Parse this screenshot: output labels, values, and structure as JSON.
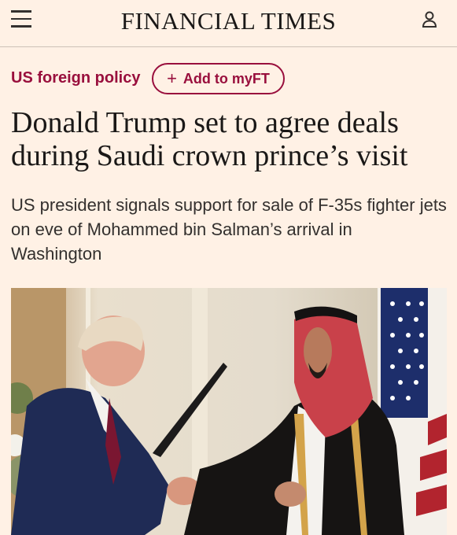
{
  "header": {
    "brand": "FINANCIAL TIMES",
    "menu_icon": "hamburger-menu-icon",
    "account_icon": "user-account-icon"
  },
  "topic": {
    "label": "US foreign policy",
    "follow_label": "Add to myFT",
    "follow_icon": "plus-icon"
  },
  "article": {
    "headline": "Donald Trump set to agree deals during Saudi crown prince’s visit",
    "standfirst": "US president signals support for sale of F-35s fighter jets on eve of Mohammed bin Salman’s arrival in Washington"
  },
  "colors": {
    "background": "#fff1e5",
    "accent": "#990f3d",
    "text": "#33302e"
  }
}
